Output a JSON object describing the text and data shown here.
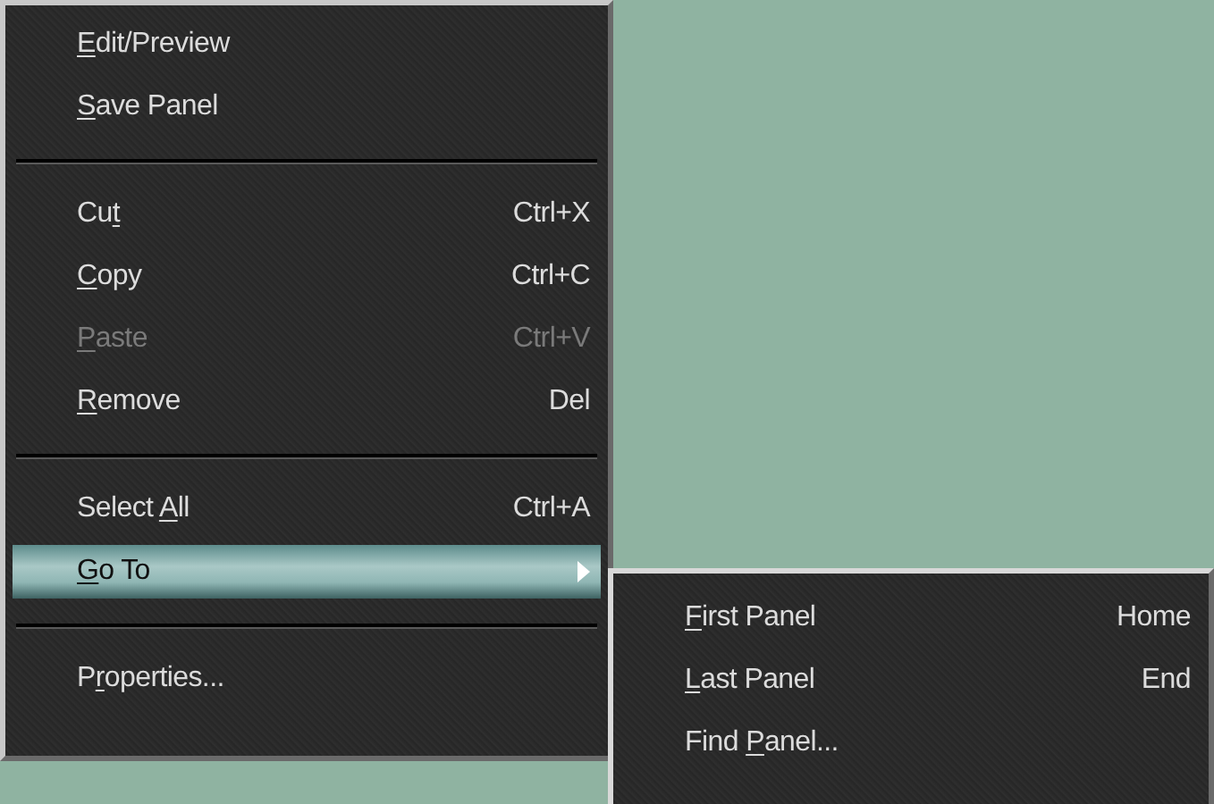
{
  "menu": {
    "items": [
      {
        "kind": "item",
        "label_parts": [
          {
            "text": "E",
            "underlined": true
          },
          {
            "text": "dit/Preview",
            "underlined": false
          }
        ],
        "disabled": false,
        "selected": false
      },
      {
        "kind": "item",
        "label_parts": [
          {
            "text": "S",
            "underlined": true
          },
          {
            "text": "ave Panel",
            "underlined": false
          }
        ],
        "disabled": false,
        "selected": false
      },
      {
        "kind": "separator"
      },
      {
        "kind": "item",
        "label_parts": [
          {
            "text": "Cu",
            "underlined": false
          },
          {
            "text": "t",
            "underlined": true
          }
        ],
        "shortcut": "Ctrl+X",
        "disabled": false,
        "selected": false
      },
      {
        "kind": "item",
        "label_parts": [
          {
            "text": "C",
            "underlined": true
          },
          {
            "text": "opy",
            "underlined": false
          }
        ],
        "shortcut": "Ctrl+C",
        "disabled": false,
        "selected": false
      },
      {
        "kind": "item",
        "label_parts": [
          {
            "text": "P",
            "underlined": true
          },
          {
            "text": "aste",
            "underlined": false
          }
        ],
        "shortcut": "Ctrl+V",
        "disabled": true,
        "selected": false
      },
      {
        "kind": "item",
        "label_parts": [
          {
            "text": "R",
            "underlined": true
          },
          {
            "text": "emove",
            "underlined": false
          }
        ],
        "shortcut": "Del",
        "disabled": false,
        "selected": false
      },
      {
        "kind": "separator"
      },
      {
        "kind": "item",
        "label_parts": [
          {
            "text": "Select ",
            "underlined": false
          },
          {
            "text": "A",
            "underlined": true
          },
          {
            "text": "ll",
            "underlined": false
          }
        ],
        "shortcut": "Ctrl+A",
        "disabled": false,
        "selected": false
      },
      {
        "kind": "item",
        "label_parts": [
          {
            "text": "G",
            "underlined": true
          },
          {
            "text": "o To",
            "underlined": false
          }
        ],
        "has_submenu": true,
        "disabled": false,
        "selected": true
      },
      {
        "kind": "separator"
      },
      {
        "kind": "item",
        "label_parts": [
          {
            "text": "P",
            "underlined": false
          },
          {
            "text": "r",
            "underlined": true
          },
          {
            "text": "operties...",
            "underlined": false
          }
        ],
        "disabled": false,
        "selected": false
      }
    ]
  },
  "submenu": {
    "items": [
      {
        "kind": "item",
        "label_parts": [
          {
            "text": "F",
            "underlined": true
          },
          {
            "text": "irst Panel",
            "underlined": false
          }
        ],
        "shortcut": "Home",
        "disabled": false,
        "selected": false
      },
      {
        "kind": "item",
        "label_parts": [
          {
            "text": "L",
            "underlined": true
          },
          {
            "text": "ast Panel",
            "underlined": false
          }
        ],
        "shortcut": "End",
        "disabled": false,
        "selected": false
      },
      {
        "kind": "item",
        "label_parts": [
          {
            "text": "Find ",
            "underlined": false
          },
          {
            "text": "P",
            "underlined": true
          },
          {
            "text": "anel...",
            "underlined": false
          }
        ],
        "disabled": false,
        "selected": false
      }
    ]
  }
}
